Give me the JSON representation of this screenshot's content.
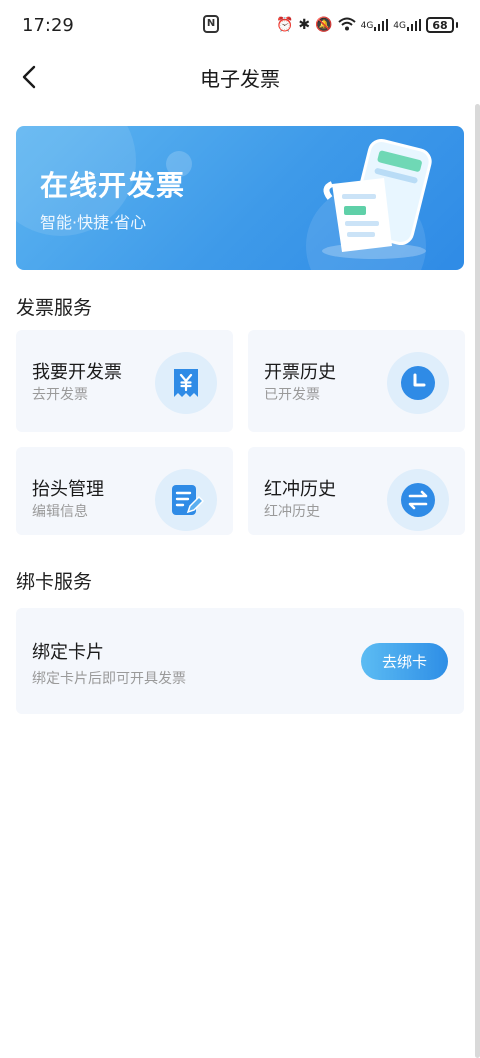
{
  "status_bar": {
    "time": "17:29",
    "nfc": "N",
    "signal_1": "4G",
    "signal_2": "4G",
    "battery": "68"
  },
  "nav": {
    "title": "电子发票"
  },
  "banner": {
    "title": "在线开发票",
    "subtitle": "智能·快捷·省心"
  },
  "invoice_services": {
    "section_title": "发票服务",
    "items": [
      {
        "title": "我要开发票",
        "subtitle": "去开发票",
        "icon": "yen-receipt-icon"
      },
      {
        "title": "开票历史",
        "subtitle": "已开发票",
        "icon": "clock-icon"
      },
      {
        "title": "抬头管理",
        "subtitle": "编辑信息",
        "icon": "edit-document-icon"
      },
      {
        "title": "红冲历史",
        "subtitle": "红冲历史",
        "icon": "swap-arrows-icon"
      }
    ]
  },
  "card_services": {
    "section_title": "绑卡服务",
    "bind_title": "绑定卡片",
    "bind_subtitle": "绑定卡片后即可开具发票",
    "bind_button": "去绑卡"
  },
  "colors": {
    "accent": "#3e9ae9",
    "card_bg": "#f4f7fc",
    "icon_bg": "#dfeefb",
    "icon_fg": "#2f8be6",
    "subtext": "#9a9a9a"
  }
}
